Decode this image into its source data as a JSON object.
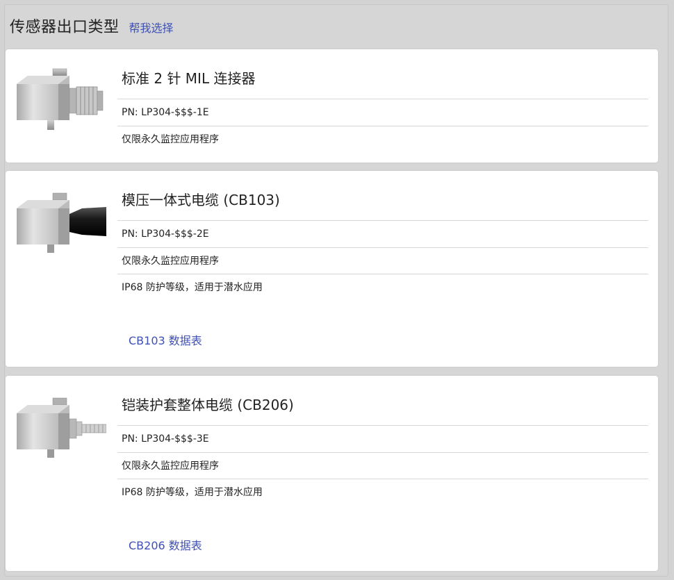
{
  "header": {
    "title": "传感器出口类型",
    "help_link": "帮我选择"
  },
  "cards": [
    {
      "title": "标准 2 针 MIL 连接器",
      "pn": "PN: LP304-$$$-1E",
      "features": [
        "仅限永久监控应用程序"
      ],
      "image_icon": "mil-connector-sensor"
    },
    {
      "title": "模压一体式电缆 (CB103)",
      "pn": "PN: LP304-$$$-2E",
      "features": [
        "仅限永久监控应用程序",
        "IP68 防护等级，适用于潜水应用"
      ],
      "datasheet": "CB103 数据表",
      "image_icon": "molded-cable-sensor"
    },
    {
      "title": "铠装护套整体电缆 (CB206)",
      "pn": "PN: LP304-$$$-3E",
      "features": [
        "仅限永久监控应用程序",
        "IP68 防护等级，适用于潜水应用"
      ],
      "datasheet": "CB206 数据表",
      "image_icon": "armored-cable-sensor"
    }
  ],
  "colors": {
    "link": "#3f51b5",
    "panel_bg": "#d6d6d6",
    "card_bg": "#ffffff",
    "divider": "#d8d8d8"
  }
}
